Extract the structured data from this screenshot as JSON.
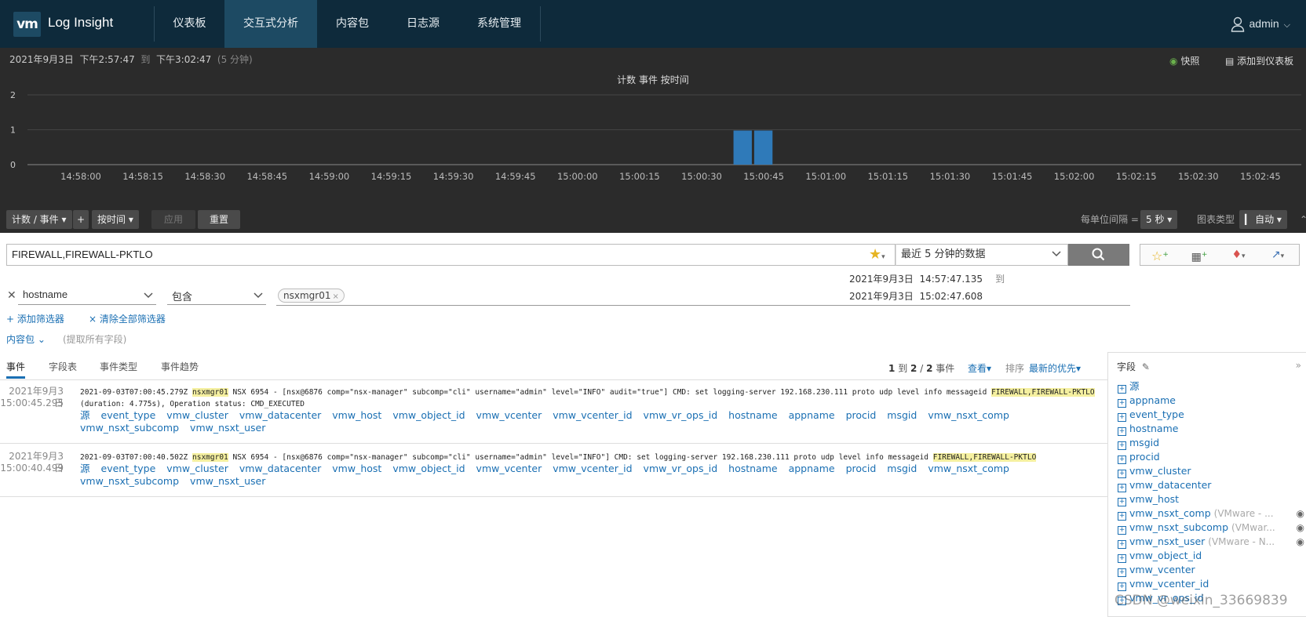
{
  "app": {
    "logo": "vm",
    "title": "Log Insight"
  },
  "nav": {
    "items": [
      "仪表板",
      "交互式分析",
      "内容包",
      "日志源",
      "系统管理"
    ],
    "active": "交互式分析"
  },
  "user": {
    "name": "admin"
  },
  "time_range": {
    "date": "2021年9月3日",
    "start": "下午2:57:47",
    "to": "到",
    "end": "下午3:02:47",
    "duration": "(5 分钟)"
  },
  "chart_actions": {
    "snapshot": "快照",
    "add_to_dashboard": "添加到仪表板"
  },
  "chart_data": {
    "type": "bar",
    "title": "计数 事件 按时间",
    "ylim": [
      0,
      2
    ],
    "yticks": [
      "2",
      "1",
      "0"
    ],
    "xticks": [
      "14:58:00",
      "14:58:15",
      "14:58:30",
      "14:58:45",
      "14:59:00",
      "14:59:15",
      "14:59:30",
      "14:59:45",
      "15:00:00",
      "15:00:15",
      "15:00:30",
      "15:00:45",
      "15:01:00",
      "15:01:15",
      "15:01:30",
      "15:01:45",
      "15:02:00",
      "15:02:15",
      "15:02:30",
      "15:02:45"
    ],
    "bars": [
      {
        "x": "15:00:40",
        "value": 1
      },
      {
        "x": "15:00:45",
        "value": 1
      }
    ],
    "bar_interval_seconds": 5,
    "grid": true,
    "bar_color": "#2f7ab9"
  },
  "toolbar": {
    "count_events": "计数 / 事件",
    "plus": "+",
    "by_time": "按时间",
    "apply": "应用",
    "reset": "重置",
    "interval_label": "每单位间隔 =",
    "interval_value": "5 秒",
    "chart_type_label": "图表类型",
    "chart_type_value": "自动"
  },
  "search": {
    "query": "FIREWALL,FIREWALL-PKTLO",
    "time_select": "最近 5 分钟的数据"
  },
  "range": {
    "from_date": "2021年9月3日",
    "from_time": "14:57:47.135",
    "to": "到",
    "to_date": "2021年9月3日",
    "to_time": "15:02:47.608"
  },
  "filter": {
    "field": "hostname",
    "operator": "包含",
    "chip": "nsxmgr01"
  },
  "filter_actions": {
    "add": "+ 添加筛选器",
    "clear": "× 清除全部筛选器",
    "content_pack": "内容包",
    "extract_all": "(提取所有字段)"
  },
  "tabs": [
    "事件",
    "字段表",
    "事件类型",
    "事件趋势"
  ],
  "results": {
    "from": "1",
    "to_word": "到",
    "shown": "2",
    "slash": "/",
    "total": "2",
    "unit": "事件",
    "view": "查看",
    "sort_label": "排序",
    "sort_value": "最新的优先"
  },
  "events": [
    {
      "date": "2021年9月3日",
      "time": "15:00:45.295",
      "pre": "2021-09-03T07:00:45.279Z ",
      "host": "nsxmgr01",
      "mid": " NSX 6954 - [nsx@6876 comp=\"nsx-manager\" subcomp=\"cli\" username=\"admin\" level=\"INFO\" audit=\"true\"] CMD: set logging-server 192.168.230.111 proto udp level info messageid ",
      "tag": "FIREWALL,FIREWALL-PKTLO",
      "post": " (duration: 4.775s), Operation status: CMD_EXECUTED"
    },
    {
      "date": "2021年9月3日",
      "time": "15:00:40.499",
      "pre": "2021-09-03T07:00:40.502Z ",
      "host": "nsxmgr01",
      "mid": " NSX 6954 - [nsx@6876 comp=\"nsx-manager\" subcomp=\"cli\" username=\"admin\" level=\"INFO\"] CMD: set logging-server 192.168.230.111 proto udp level info messageid ",
      "tag": "FIREWALL,FIREWALL-PKTLO",
      "post": ""
    }
  ],
  "event_fields": [
    "源",
    "event_type",
    "vmw_cluster",
    "vmw_datacenter",
    "vmw_host",
    "vmw_object_id",
    "vmw_vcenter",
    "vmw_vcenter_id",
    "vmw_vr_ops_id",
    "hostname",
    "appname",
    "procid",
    "msgid",
    "vmw_nsxt_comp",
    "vmw_nsxt_subcomp",
    "vmw_nsxt_user"
  ],
  "fields_panel": {
    "title": "字段",
    "items": [
      {
        "name": "源"
      },
      {
        "name": "appname"
      },
      {
        "name": "event_type"
      },
      {
        "name": "hostname"
      },
      {
        "name": "msgid"
      },
      {
        "name": "procid"
      },
      {
        "name": "vmw_cluster"
      },
      {
        "name": "vmw_datacenter"
      },
      {
        "name": "vmw_host"
      },
      {
        "name": "vmw_nsxt_comp",
        "sub": "(VMware - ...",
        "eye": true
      },
      {
        "name": "vmw_nsxt_subcomp",
        "sub": "(VMwar...",
        "eye": true
      },
      {
        "name": "vmw_nsxt_user",
        "sub": "(VMware - N...",
        "eye": true
      },
      {
        "name": "vmw_object_id"
      },
      {
        "name": "vmw_vcenter"
      },
      {
        "name": "vmw_vcenter_id"
      },
      {
        "name": "vmw_vr_ops_id"
      }
    ]
  },
  "watermark": "CSDN @weixin_33669839"
}
